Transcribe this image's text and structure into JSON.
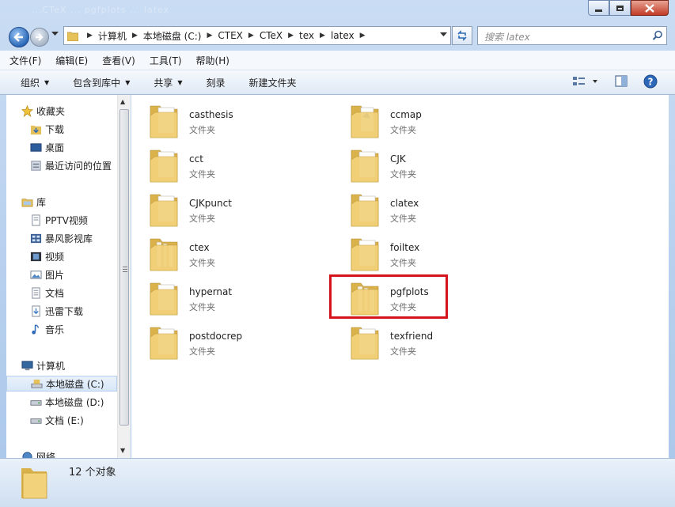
{
  "window": {
    "caption_ghost": "...CTeX ... pgfplots ... latex"
  },
  "address": {
    "crumbs": [
      "计算机",
      "本地磁盘 (C:)",
      "CTEX",
      "CTeX",
      "tex",
      "latex"
    ],
    "search_placeholder": "搜索 latex"
  },
  "menu": [
    "文件(F)",
    "编辑(E)",
    "查看(V)",
    "工具(T)",
    "帮助(H)"
  ],
  "commands": {
    "organize": "组织",
    "include_library": "包含到库中",
    "share": "共享",
    "burn": "刻录",
    "new_folder": "新建文件夹"
  },
  "sidebar": {
    "favorites": "收藏夹",
    "downloads": "下载",
    "desktop": "桌面",
    "recent": "最近访问的位置",
    "libraries": "库",
    "pptv": "PPTV视频",
    "baofeng": "暴风影视库",
    "videos": "视频",
    "pictures": "图片",
    "documents": "文档",
    "xunlei": "迅雷下载",
    "music": "音乐",
    "computer": "计算机",
    "drive_c": "本地磁盘 (C:)",
    "drive_d": "本地磁盘 (D:)",
    "drive_e": "文档 (E:)",
    "network": "网络"
  },
  "folders": [
    {
      "name": "casthesis",
      "type": "文件夹"
    },
    {
      "name": "ccmap",
      "type": "文件夹"
    },
    {
      "name": "cct",
      "type": "文件夹"
    },
    {
      "name": "CJK",
      "type": "文件夹"
    },
    {
      "name": "CJKpunct",
      "type": "文件夹"
    },
    {
      "name": "clatex",
      "type": "文件夹"
    },
    {
      "name": "ctex",
      "type": "文件夹"
    },
    {
      "name": "foiltex",
      "type": "文件夹"
    },
    {
      "name": "hypernat",
      "type": "文件夹"
    },
    {
      "name": "pgfplots",
      "type": "文件夹"
    },
    {
      "name": "postdocrep",
      "type": "文件夹"
    },
    {
      "name": "texfriend",
      "type": "文件夹"
    }
  ],
  "status": {
    "count_text": "12 个对象"
  },
  "colors": {
    "highlight": "#d4141c",
    "folder": "#f2d27a",
    "frame": "#a9c6ea"
  }
}
